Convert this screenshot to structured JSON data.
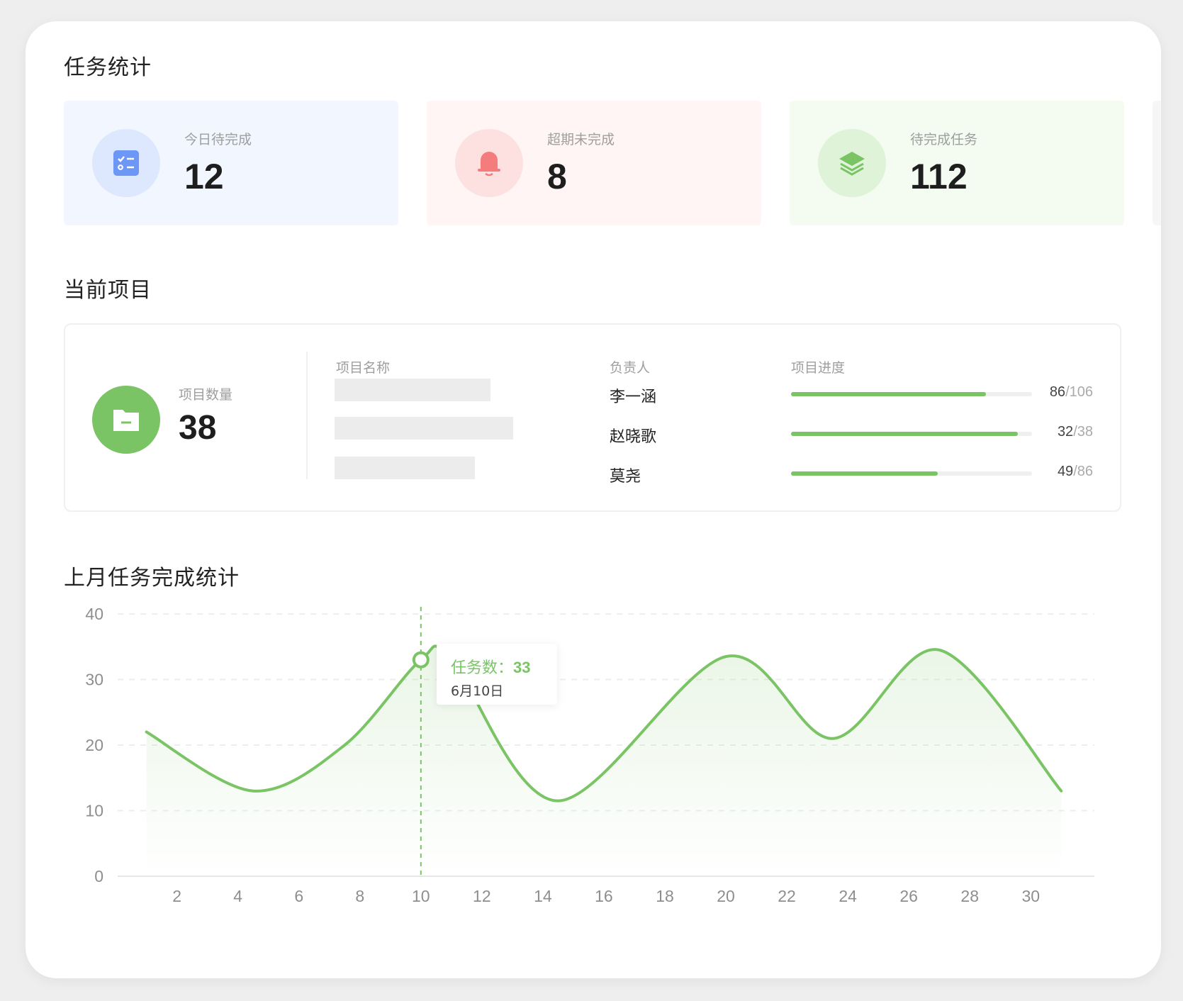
{
  "task_stats": {
    "title": "任务统计",
    "cards": [
      {
        "label": "今日待完成",
        "value": "12",
        "icon": "checklist-icon",
        "bg": "#f2f6ff",
        "circle": "#dde7fd",
        "accent": "#6d97f4"
      },
      {
        "label": "超期未完成",
        "value": "8",
        "icon": "bell-icon",
        "bg": "#fff5f5",
        "circle": "#fde1e1",
        "accent": "#f47c7c"
      },
      {
        "label": "待完成任务",
        "value": "112",
        "icon": "layers-icon",
        "bg": "#f4fbf1",
        "circle": "#def3d7",
        "accent": "#7ac465"
      }
    ]
  },
  "current_projects": {
    "title": "当前项目",
    "count_label": "项目数量",
    "count": "38",
    "icon": "folder-icon",
    "columns": {
      "name": "项目名称",
      "owner": "负责人",
      "progress": "项目进度"
    },
    "rows": [
      {
        "owner": "李一涵",
        "done": "86",
        "total": "/106",
        "ratio": 0.81
      },
      {
        "owner": "赵晓歌",
        "done": "32",
        "total": "/38",
        "ratio": 0.94
      },
      {
        "owner": "莫尧",
        "done": "49",
        "total": "/86",
        "ratio": 0.61
      }
    ]
  },
  "chart_section": {
    "title": "上月任务完成统计",
    "tooltip": {
      "label": "任务数：",
      "value": "33",
      "date": "6月10日"
    }
  },
  "chart_data": {
    "type": "area",
    "title": "上月任务完成统计",
    "xlim": [
      0.8,
      31.9
    ],
    "ylim": [
      0,
      40
    ],
    "x_ticks": [
      2,
      4,
      6,
      8,
      10,
      12,
      14,
      16,
      18,
      20,
      22,
      24,
      26,
      28,
      30
    ],
    "y_ticks": [
      0,
      10,
      20,
      30,
      40
    ],
    "grid": true,
    "color": "#7ac465",
    "series": [
      {
        "x": [
          1,
          4.5,
          7.5,
          10,
          11,
          14.5,
          20,
          23.5,
          27,
          31
        ],
        "y": [
          22,
          13,
          20,
          33,
          33,
          11.5,
          33.5,
          21,
          34.5,
          13
        ]
      }
    ],
    "highlight": {
      "x": 10,
      "y": 33
    }
  }
}
